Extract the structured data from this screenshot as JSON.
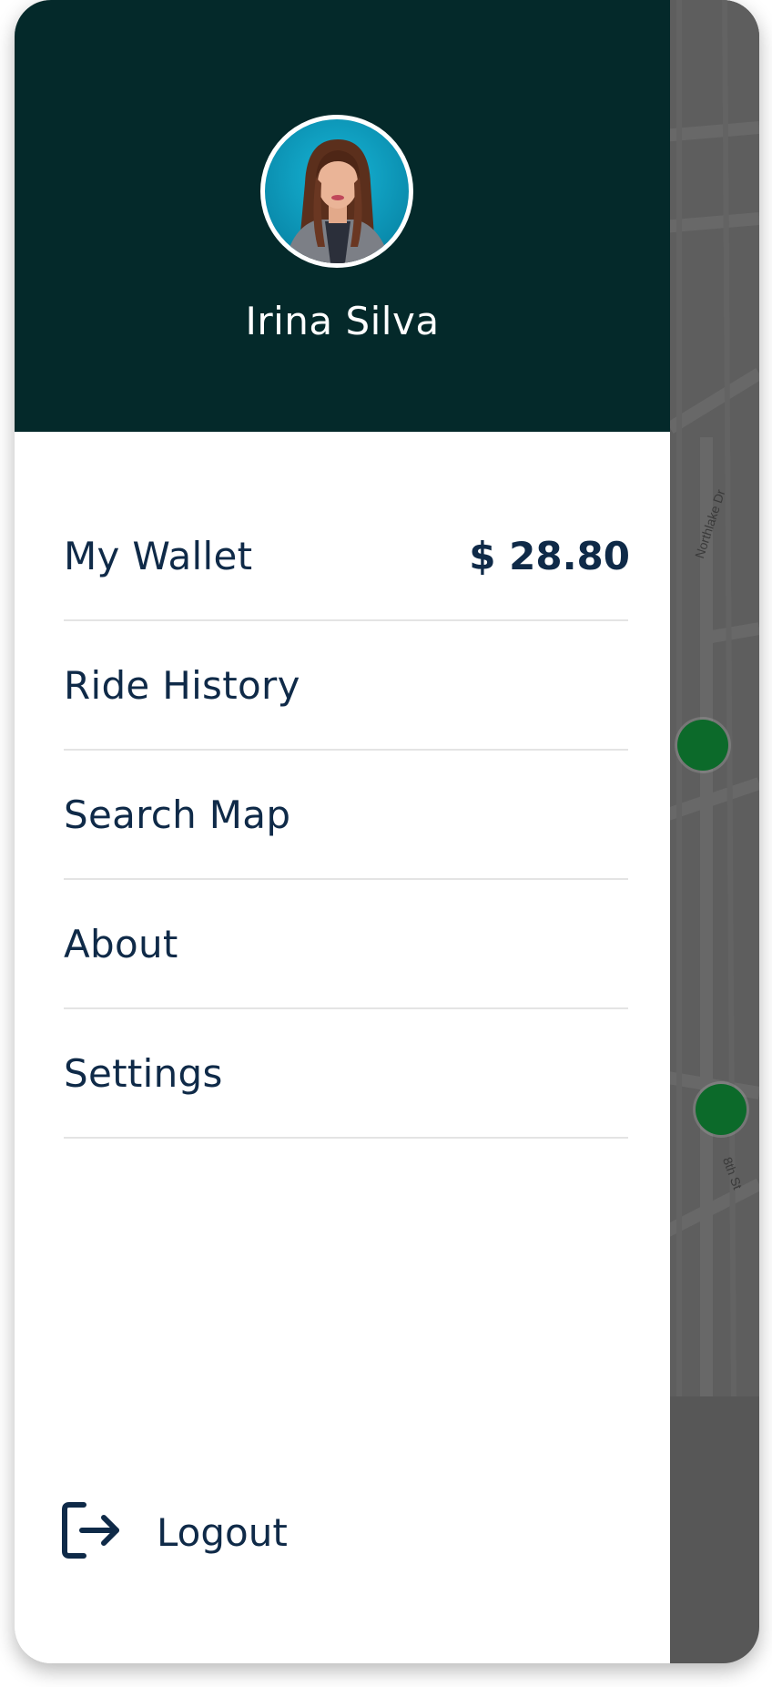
{
  "profile": {
    "name": "Irina Silva"
  },
  "menu": {
    "items": [
      {
        "label": "My Wallet",
        "value": "$ 28.80"
      },
      {
        "label": "Ride History"
      },
      {
        "label": "Search Map"
      },
      {
        "label": "About"
      },
      {
        "label": "Settings"
      }
    ]
  },
  "logout": {
    "label": "Logout",
    "icon": "logout-icon"
  },
  "map": {
    "streets": [
      "Northlake Dr",
      "8th St"
    ],
    "pin_color": "#0c6a2a"
  },
  "colors": {
    "header_bg": "#04292a",
    "text": "#0f2a48",
    "map_bg": "#5e5e5e"
  }
}
